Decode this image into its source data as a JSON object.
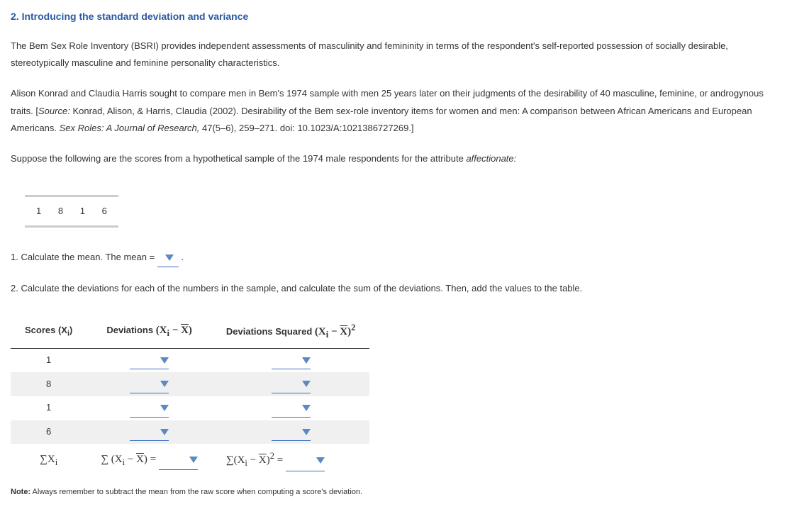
{
  "heading": "2. Introducing the standard deviation and variance",
  "para1": "The Bem Sex Role Inventory (BSRI) provides independent assessments of masculinity and femininity in terms of the respondent's self-reported possession of socially desirable, stereotypically masculine and feminine personality characteristics.",
  "para2_a": "Alison Konrad and Claudia Harris sought to compare men in Bem's 1974 sample with men 25 years later on their judgments of the desirability of 40 masculine, feminine, or androgynous traits. [",
  "para2_src_label": "Source:",
  "para2_b": " Konrad, Alison, & Harris, Claudia (2002). Desirability of the Bem sex-role inventory items for women and men: A comparison between African Americans and European Americans. ",
  "para2_journal": "Sex Roles: A Journal of Research,",
  "para2_c": " 47(5–6), 259–271. doi: 10.1023/A:1021386727269.]",
  "para3_a": "Suppose the following are the scores from a hypothetical sample of the 1974 male respondents for the attribute ",
  "para3_attr": "affectionate:",
  "scores": [
    "1",
    "8",
    "1",
    "6"
  ],
  "q1_a": "1. Calculate the mean. The mean = ",
  "q1_b": " .",
  "q2": "2. Calculate the deviations for each of the numbers in the sample, and calculate the sum of the deviations. Then, add the values to the table.",
  "table": {
    "col1": "Scores (X",
    "col1_sub": "i",
    "col1_end": ")",
    "col2_a": "Deviations ",
    "col2_math": "(X",
    "col2_sub": "i",
    "col2_mid": " − ",
    "col2_xbar": "X",
    "col2_end": ")",
    "col3_a": "Deviations Squared ",
    "col3_math": "(X",
    "col3_sub": "i",
    "col3_mid": " − ",
    "col3_xbar": "X",
    "col3_end": ")",
    "col3_sup": "2",
    "rows": [
      "1",
      "8",
      "1",
      "6"
    ],
    "sum1": "∑X",
    "sum1_sub": "i",
    "sum2_a": "∑ (X",
    "sum2_sub": "i",
    "sum2_b": " − ",
    "sum2_xbar": "X",
    "sum2_c": ") = ",
    "sum3_a": "∑(X",
    "sum3_sub": "i",
    "sum3_b": " − ",
    "sum3_xbar": "X",
    "sum3_c": ")",
    "sum3_sup": "2",
    "sum3_d": " = "
  },
  "note_label": "Note:",
  "note_text": " Always remember to subtract the mean from the raw score when computing a score's deviation."
}
